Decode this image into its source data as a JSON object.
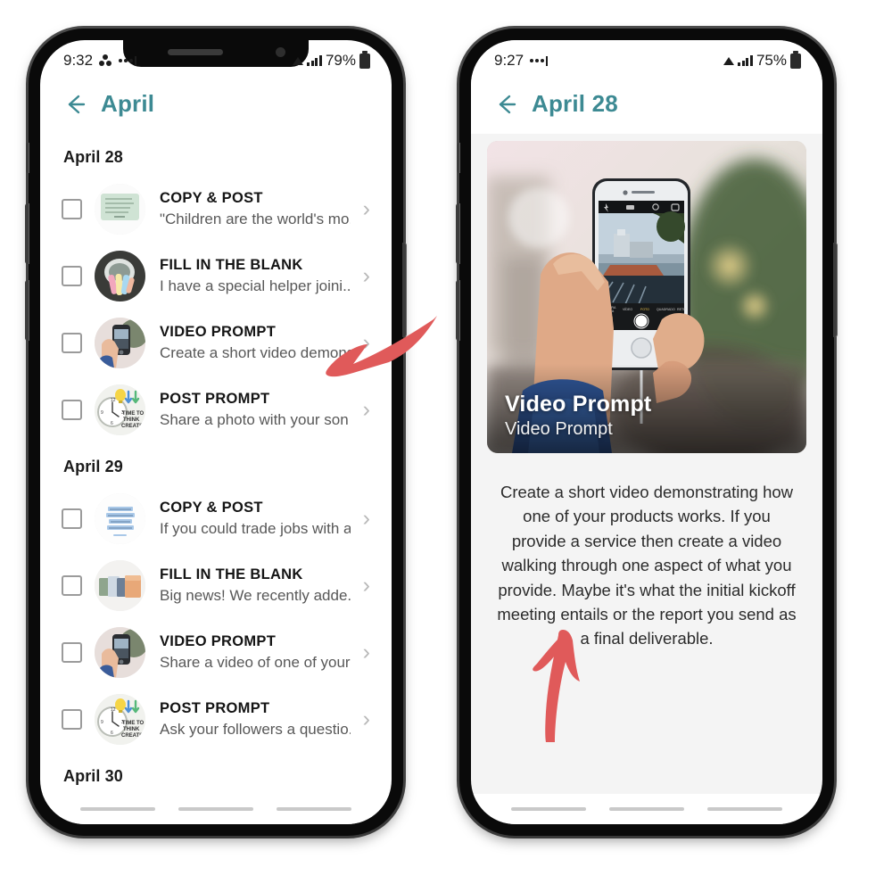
{
  "left_phone": {
    "status_bar": {
      "time": "9:32",
      "battery_percent": "79%",
      "icons": [
        "clover-icon",
        "signal-dots-icon",
        "wifi-icon",
        "cellular-bars-icon",
        "battery-icon"
      ]
    },
    "header": {
      "back_label": "back-arrow",
      "title": "April"
    },
    "sections": [
      {
        "date": "April 28",
        "items": [
          {
            "title": "COPY & POST",
            "subtitle": "\"Children are the world's mo...",
            "thumb": "quote-green-watercolor",
            "checked": false
          },
          {
            "title": "FILL IN THE BLANK",
            "subtitle": "I have a special helper joini...",
            "thumb": "colorful-chalk-bowl",
            "checked": false
          },
          {
            "title": "VIDEO PROMPT",
            "subtitle": "Create a short video demons...",
            "thumb": "hand-holding-phone",
            "checked": false
          },
          {
            "title": "POST PROMPT",
            "subtitle": "Share a photo with your son ...",
            "thumb": "clock-time-to-think-creative",
            "checked": false
          }
        ]
      },
      {
        "date": "April 29",
        "items": [
          {
            "title": "COPY & POST",
            "subtitle": "If you could trade jobs with a...",
            "thumb": "blue-text-quote",
            "checked": false
          },
          {
            "title": "FILL IN THE BLANK",
            "subtitle": "Big news! We recently adde...",
            "thumb": "soap-bars",
            "checked": false
          },
          {
            "title": "VIDEO PROMPT",
            "subtitle": "Share a video of one of your ...",
            "thumb": "hand-holding-phone",
            "checked": false
          },
          {
            "title": "POST PROMPT",
            "subtitle": "Ask your followers a questio...",
            "thumb": "clock-time-to-think-creative",
            "checked": false
          }
        ]
      },
      {
        "date": "April 30",
        "items": []
      }
    ]
  },
  "right_phone": {
    "status_bar": {
      "time": "9:27",
      "battery_percent": "75%",
      "icons": [
        "signal-dots-icon",
        "wifi-icon",
        "cellular-bars-icon",
        "battery-icon"
      ]
    },
    "header": {
      "back_label": "back-arrow",
      "title": "April 28"
    },
    "hero": {
      "title": "Video Prompt",
      "subtitle": "Video Prompt",
      "image": "hand-holding-iphone-camera-bokeh"
    },
    "body": "Create a short video demonstrating how one of your products works. If you provide a service then create a video walking through one aspect of what you provide. Maybe it's what the initial kickoff meeting entails or the report you send as a final deliverable."
  },
  "annotations": [
    {
      "name": "arrow-pointing-to-video-prompt-row",
      "color": "#e05a5a",
      "direction": "down-left"
    },
    {
      "name": "arrow-pointing-to-body-text",
      "color": "#e05a5a",
      "direction": "up"
    }
  ],
  "theme": {
    "accent": "#3d8a93",
    "arrow_red": "#e05a5a",
    "text_primary": "#141414",
    "text_secondary": "#585858",
    "screen_bg": "#ffffff",
    "detail_bg": "#f4f4f4"
  }
}
